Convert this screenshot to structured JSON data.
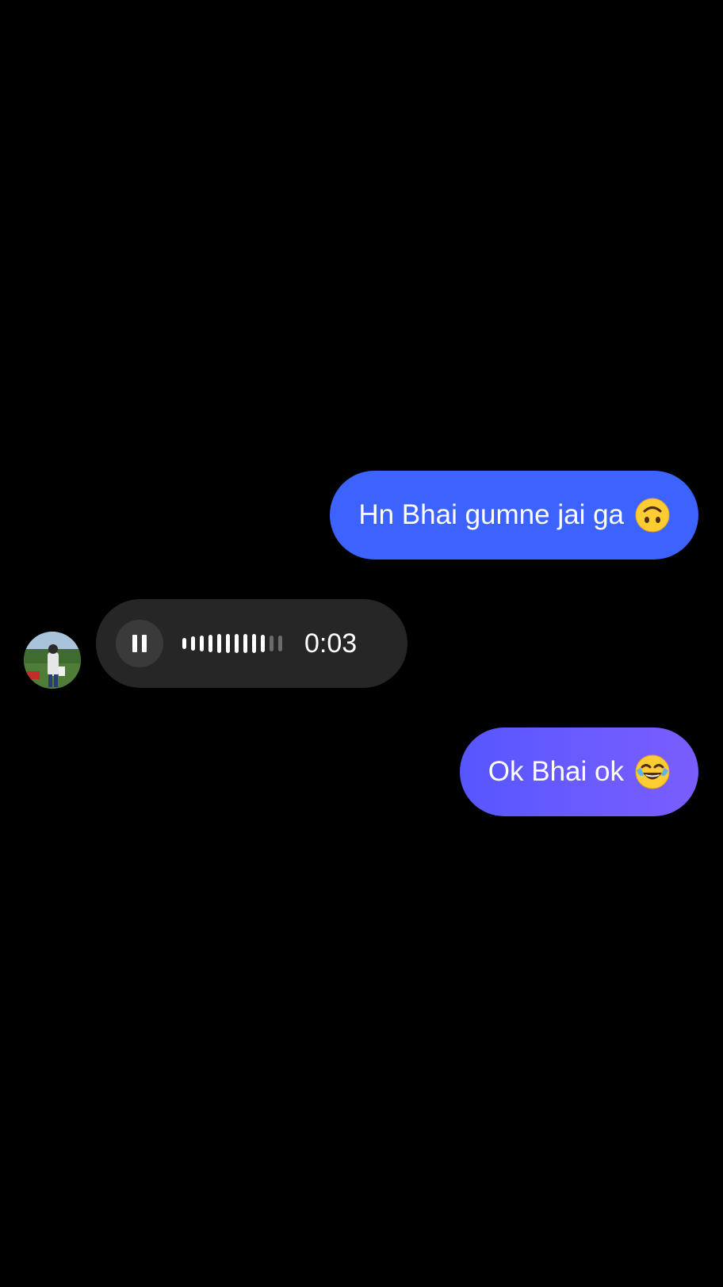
{
  "messages": [
    {
      "direction": "outgoing",
      "text": "Hn Bhai gumne jai ga",
      "emoji": "upside-down-face",
      "bubble_color": "#3d63ff"
    },
    {
      "direction": "incoming",
      "type": "voice",
      "duration": "0:03",
      "state": "playing",
      "bubble_color": "#262626"
    },
    {
      "direction": "outgoing",
      "text": "Ok Bhai ok",
      "emoji": "face-with-tears-of-joy",
      "bubble_color": "#6a5cff"
    }
  ],
  "voice_player": {
    "button_icon": "pause-icon",
    "played_fraction": 0.8,
    "waveform_levels": [
      0.35,
      0.45,
      0.5,
      0.55,
      0.6,
      0.6,
      0.6,
      0.6,
      0.6,
      0.55,
      0.5,
      0.5
    ]
  },
  "colors": {
    "background": "#000000",
    "outgoing_blue": "#3d63ff",
    "outgoing_purple": "#6a5cff",
    "incoming_gray": "#262626"
  }
}
